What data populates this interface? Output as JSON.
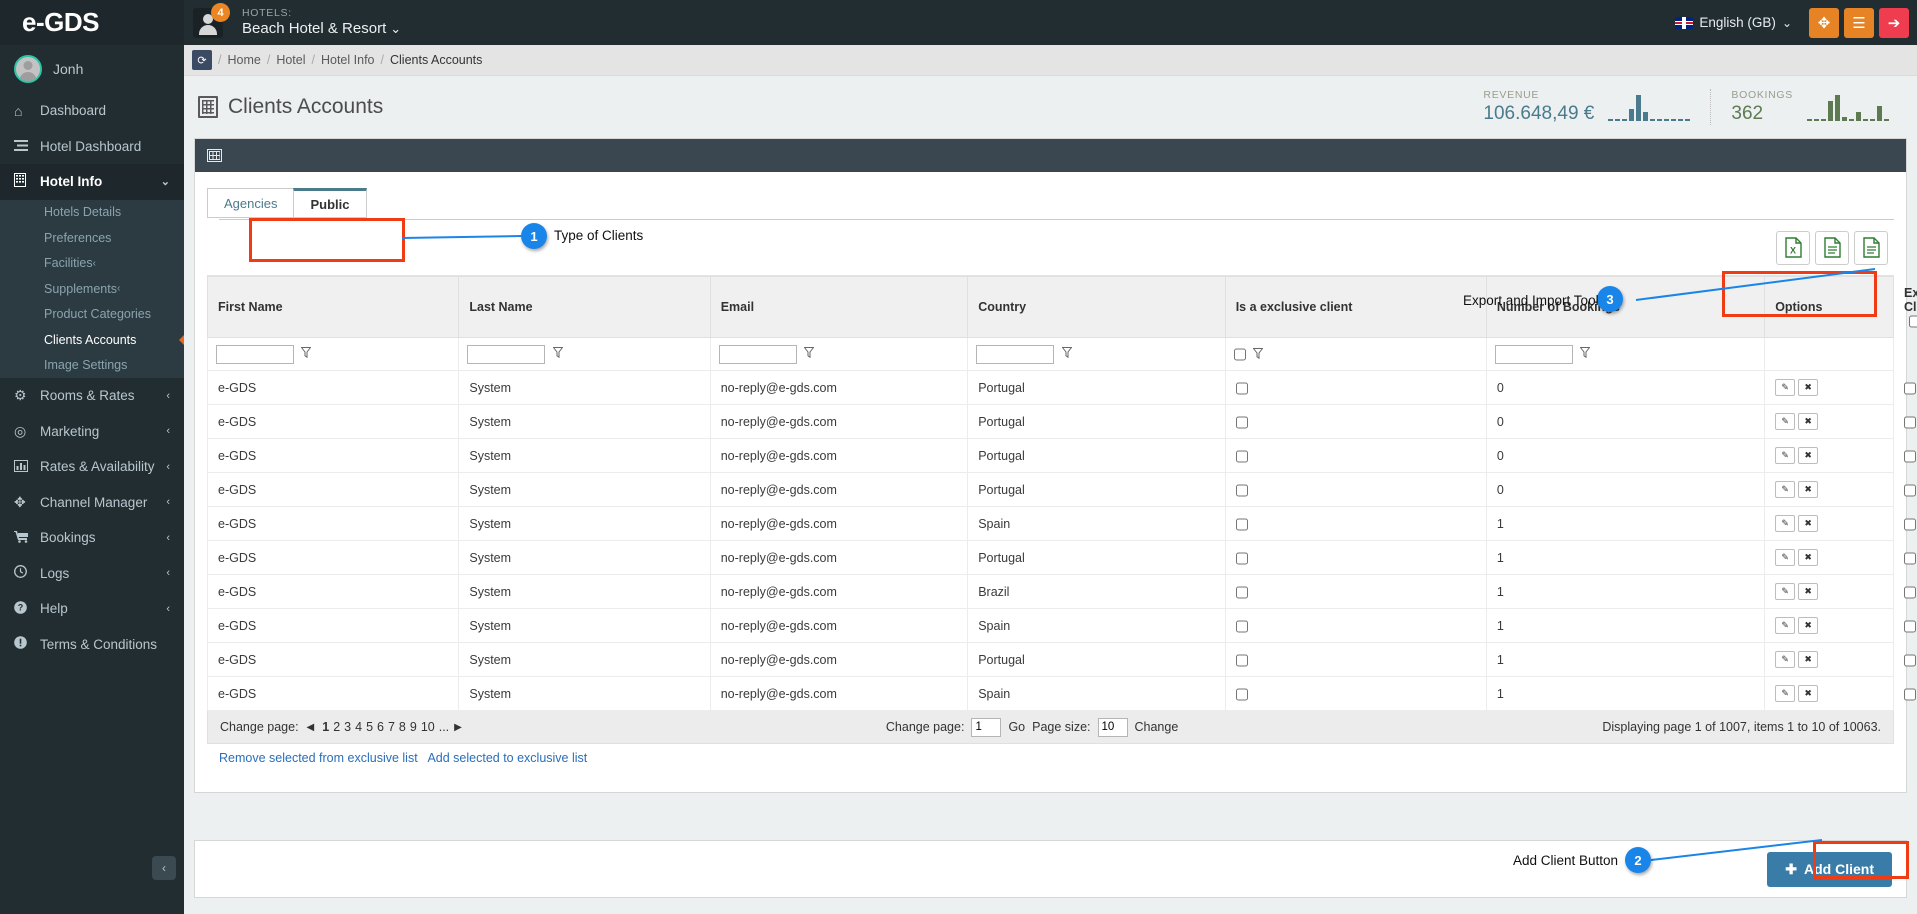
{
  "topbar": {
    "brand": "e-GDS",
    "notification_count": "4",
    "hotels_label": "HOTELS:",
    "hotel_name": "Beach Hotel & Resort",
    "hotel_caret": "⌄",
    "language": "English (GB)",
    "language_caret": "⌄",
    "fullscreen_icon": "✥",
    "menu_icon": "☰",
    "logout_icon": "➔"
  },
  "sidebar": {
    "user_name": "Jonh",
    "items": [
      {
        "label": "Dashboard",
        "icon": "home-icon",
        "glyph": "⌂",
        "has_children": false
      },
      {
        "label": "Hotel Dashboard",
        "icon": "list-icon",
        "glyph": "☰",
        "has_children": false
      },
      {
        "label": "Hotel Info",
        "icon": "building-icon",
        "glyph": "▤",
        "has_children": true,
        "expanded": true,
        "chevron": "⌄"
      },
      {
        "label": "Rooms & Rates",
        "icon": "gears-icon",
        "glyph": "⚙",
        "has_children": true,
        "chevron": "‹"
      },
      {
        "label": "Marketing",
        "icon": "target-icon",
        "glyph": "◎",
        "has_children": true,
        "chevron": "‹"
      },
      {
        "label": "Rates & Availability",
        "icon": "bar-chart-icon",
        "glyph": "▥",
        "has_children": true,
        "chevron": "‹"
      },
      {
        "label": "Channel Manager",
        "icon": "move-arrows-icon",
        "glyph": "✥",
        "has_children": true,
        "chevron": "‹"
      },
      {
        "label": "Bookings",
        "icon": "cart-icon",
        "glyph": "🛒",
        "has_children": true,
        "chevron": "‹"
      },
      {
        "label": "Logs",
        "icon": "clock-icon",
        "glyph": "◔",
        "has_children": true,
        "chevron": "‹"
      },
      {
        "label": "Help",
        "icon": "question-circle-icon",
        "glyph": "?",
        "has_children": true,
        "chevron": "‹"
      },
      {
        "label": "Terms & Conditions",
        "icon": "exclamation-circle-icon",
        "glyph": "!",
        "has_children": false
      }
    ],
    "hotel_info_children": [
      {
        "label": "Hotels Details"
      },
      {
        "label": "Preferences"
      },
      {
        "label": "Facilities"
      },
      {
        "label": "Supplements"
      },
      {
        "label": "Product Categories"
      },
      {
        "label": "Clients Accounts"
      },
      {
        "label": "Image Settings"
      }
    ],
    "collapse_icon": "‹"
  },
  "breadcrumb": {
    "refresh_icon": "⟳",
    "items": [
      "Home",
      "Hotel",
      "Hotel Info",
      "Clients Accounts"
    ],
    "separator": "/"
  },
  "page": {
    "title": "Clients Accounts"
  },
  "stats": [
    {
      "label": "REVENUE",
      "value": "106.648,49 €",
      "color": "#4a7b8c",
      "bars": [
        2,
        2,
        2,
        10,
        22,
        8,
        2,
        2,
        2,
        2,
        2,
        2
      ]
    },
    {
      "label": "BOOKINGS",
      "value": "362",
      "color": "#5d7a52",
      "bars": [
        2,
        2,
        2,
        18,
        24,
        4,
        2,
        8,
        2,
        2,
        14,
        2
      ]
    }
  ],
  "tabs": [
    {
      "label": "Agencies",
      "active": false
    },
    {
      "label": "Public",
      "active": true
    }
  ],
  "export": {
    "label": "Export and Import Tool",
    "buttons": [
      {
        "name": "export-excel-button",
        "icon": "excel-file-icon",
        "letter": "X"
      },
      {
        "name": "export-document-button",
        "icon": "text-file-icon",
        "letter": ""
      },
      {
        "name": "import-document-button",
        "icon": "text-file-icon",
        "letter": ""
      }
    ]
  },
  "table": {
    "columns": [
      "First Name",
      "Last Name",
      "Email",
      "Country",
      "Is a exclusive client",
      "Number of Bookings",
      "Options",
      "Exclusive Client"
    ],
    "header_checkbox_column": "Exclusive Client",
    "filter_row": {
      "first_name": "",
      "last_name": "",
      "email": "",
      "country": "",
      "is_exclusive_checked": false,
      "number_of_bookings": ""
    },
    "option_buttons": [
      {
        "name": "edit-row-button",
        "glyph": "✎"
      },
      {
        "name": "delete-row-button",
        "glyph": "✖"
      }
    ],
    "rows": [
      {
        "first_name": "e-GDS",
        "last_name": "System",
        "email": "no-reply@e-gds.com",
        "country": "Portugal",
        "is_exclusive": false,
        "bookings": "0",
        "exclusive_client": false
      },
      {
        "first_name": "e-GDS",
        "last_name": "System",
        "email": "no-reply@e-gds.com",
        "country": "Portugal",
        "is_exclusive": false,
        "bookings": "0",
        "exclusive_client": false
      },
      {
        "first_name": "e-GDS",
        "last_name": "System",
        "email": "no-reply@e-gds.com",
        "country": "Portugal",
        "is_exclusive": false,
        "bookings": "0",
        "exclusive_client": false
      },
      {
        "first_name": "e-GDS",
        "last_name": "System",
        "email": "no-reply@e-gds.com",
        "country": "Portugal",
        "is_exclusive": false,
        "bookings": "0",
        "exclusive_client": false
      },
      {
        "first_name": "e-GDS",
        "last_name": "System",
        "email": "no-reply@e-gds.com",
        "country": "Spain",
        "is_exclusive": false,
        "bookings": "1",
        "exclusive_client": false
      },
      {
        "first_name": "e-GDS",
        "last_name": "System",
        "email": "no-reply@e-gds.com",
        "country": "Portugal",
        "is_exclusive": false,
        "bookings": "1",
        "exclusive_client": false
      },
      {
        "first_name": "e-GDS",
        "last_name": "System",
        "email": "no-reply@e-gds.com",
        "country": "Brazil",
        "is_exclusive": false,
        "bookings": "1",
        "exclusive_client": false
      },
      {
        "first_name": "e-GDS",
        "last_name": "System",
        "email": "no-reply@e-gds.com",
        "country": "Spain",
        "is_exclusive": false,
        "bookings": "1",
        "exclusive_client": false
      },
      {
        "first_name": "e-GDS",
        "last_name": "System",
        "email": "no-reply@e-gds.com",
        "country": "Portugal",
        "is_exclusive": false,
        "bookings": "1",
        "exclusive_client": false
      },
      {
        "first_name": "e-GDS",
        "last_name": "System",
        "email": "no-reply@e-gds.com",
        "country": "Spain",
        "is_exclusive": false,
        "bookings": "1",
        "exclusive_client": false
      }
    ]
  },
  "pager": {
    "change_page_label": "Change page:",
    "prev_arrow": "◀",
    "next_arrow": "▶",
    "pages": [
      "1",
      "2",
      "3",
      "4",
      "5",
      "6",
      "7",
      "8",
      "9",
      "10",
      "..."
    ],
    "current_page": "1",
    "goto_label": "Change page:",
    "goto_value": "1",
    "go_button": "Go",
    "page_size_label": "Page size:",
    "page_size_value": "10",
    "change_button": "Change",
    "summary": "Displaying page 1 of 1007, items 1 to 10 of 10063."
  },
  "bulk_links": {
    "remove": "Remove selected from exclusive list",
    "add": "Add selected to exclusive list"
  },
  "footer": {
    "add_client_label": "Add Client",
    "add_client_plus": "✚"
  },
  "annotations": [
    {
      "number": "1",
      "label": "Type of Clients"
    },
    {
      "number": "2",
      "label": "Add Client Button"
    },
    {
      "number": "3",
      "label": "Export and Import Tool"
    }
  ],
  "colors": {
    "accent_blue": "#1a85e8",
    "annotation_red": "#f03c15",
    "sidebar_dark": "#222d32",
    "button_blue": "#3a7ca8",
    "orange": "#e58325",
    "red": "#ef3d4f"
  }
}
